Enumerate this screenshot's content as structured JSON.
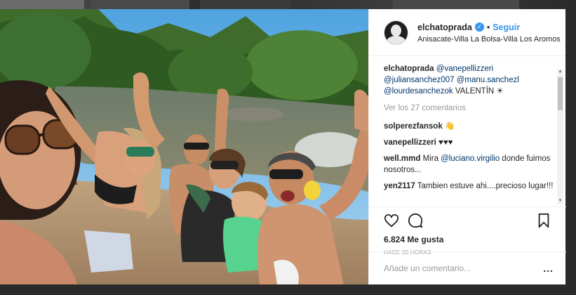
{
  "post": {
    "username": "elchatoprada",
    "follow_label": "Seguir",
    "separator": "•",
    "location": "Anisacate-Villa La Bolsa-Villa Los Aromos",
    "verified_glyph": "✓"
  },
  "caption": {
    "user": "elchatoprada",
    "mentions": [
      "@vanepellizzeri",
      "@juliansanchez007",
      "@manu.sanchezl",
      "@lourdesanchezok"
    ],
    "text": "VALENTÍN ☀"
  },
  "view_all_label": "Ver los 27 comentarios",
  "comments": [
    {
      "user": "solperezfansok",
      "text": "👋"
    },
    {
      "user": "vanepellizzeri",
      "text": "♥♥♥"
    },
    {
      "user": "well.mmd",
      "pre": "Mira",
      "mention": "@luciano.virgilio",
      "text": "donde fuimos nosotros..."
    },
    {
      "user": "yen2117",
      "text": "Tambien estuve ahi....precioso lugar!!!"
    }
  ],
  "actions": {
    "icons": [
      "heart-icon",
      "comment-icon",
      "bookmark-icon"
    ],
    "likes": "6.824 Me gusta",
    "time": "HACE 20 HORAS"
  },
  "add_comment": {
    "placeholder": "Añade un comentario...",
    "more_label": "..."
  },
  "colors": {
    "link": "#3897f0",
    "mention": "#003569",
    "text": "#262626",
    "muted": "#999999"
  }
}
